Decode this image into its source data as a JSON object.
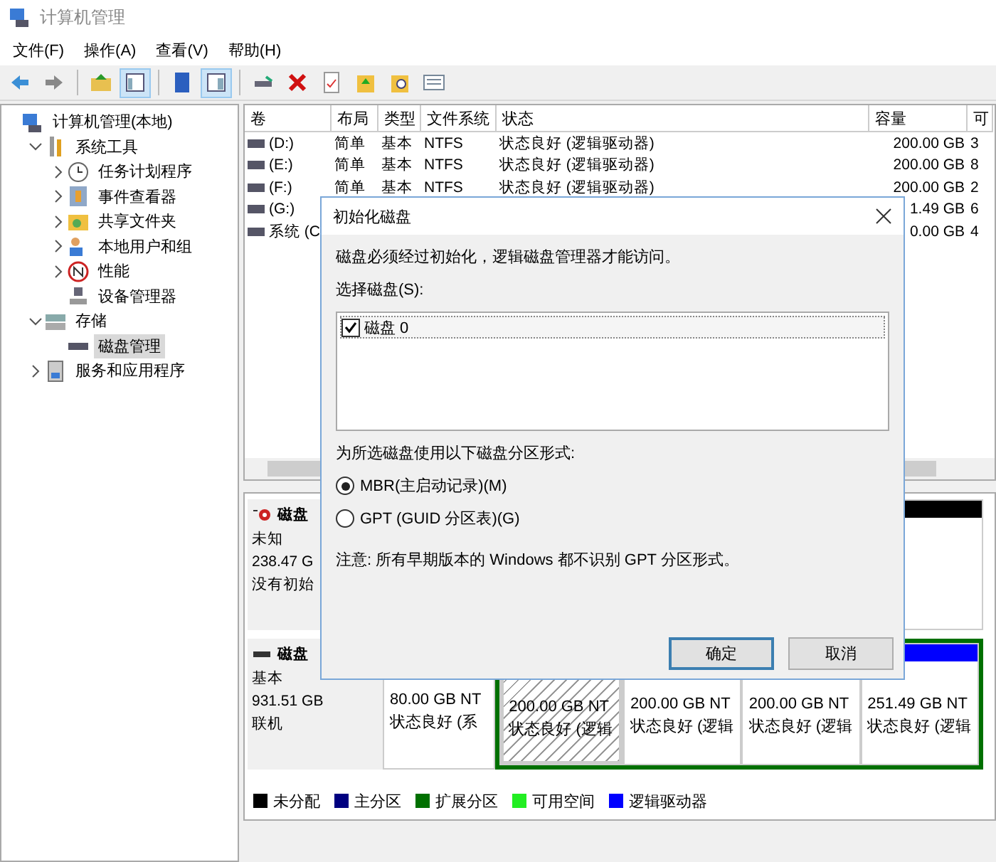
{
  "window": {
    "title": "计算机管理"
  },
  "menu": [
    {
      "label": "文件(F)"
    },
    {
      "label": "操作(A)"
    },
    {
      "label": "查看(V)"
    },
    {
      "label": "帮助(H)"
    }
  ],
  "toolbar": [
    {
      "kind": "back",
      "pressed": false
    },
    {
      "kind": "forward",
      "pressed": false
    },
    {
      "kind": "sep"
    },
    {
      "kind": "up",
      "pressed": false
    },
    {
      "kind": "tree",
      "pressed": true
    },
    {
      "kind": "sep"
    },
    {
      "kind": "help",
      "pressed": false
    },
    {
      "kind": "panel",
      "pressed": true
    },
    {
      "kind": "sep"
    },
    {
      "kind": "drive",
      "pressed": false
    },
    {
      "kind": "delete",
      "pressed": false
    },
    {
      "kind": "check",
      "pressed": false
    },
    {
      "kind": "folder-up",
      "pressed": false
    },
    {
      "kind": "folder-search",
      "pressed": false
    },
    {
      "kind": "list",
      "pressed": false
    }
  ],
  "tree": [
    {
      "label": "计算机管理(本地)",
      "kind": "computer",
      "selected": false,
      "children": [
        {
          "label": "系统工具",
          "kind": "tools",
          "expanded": true,
          "selected": false,
          "children": [
            {
              "label": "任务计划程序",
              "kind": "clock",
              "expanded": false,
              "selected": false
            },
            {
              "label": "事件查看器",
              "kind": "event",
              "expanded": false,
              "selected": false
            },
            {
              "label": "共享文件夹",
              "kind": "share",
              "expanded": false,
              "selected": false
            },
            {
              "label": "本地用户和组",
              "kind": "users",
              "expanded": false,
              "selected": false
            },
            {
              "label": "性能",
              "kind": "perf",
              "expanded": false,
              "selected": false
            },
            {
              "label": "设备管理器",
              "kind": "device",
              "selected": false
            }
          ]
        },
        {
          "label": "存储",
          "kind": "storage",
          "expanded": true,
          "selected": false,
          "children": [
            {
              "label": "磁盘管理",
              "kind": "disk",
              "selected": true
            }
          ]
        },
        {
          "label": "服务和应用程序",
          "kind": "services",
          "expanded": false,
          "selected": false
        }
      ]
    }
  ],
  "table": {
    "columns": [
      "卷",
      "布局",
      "类型",
      "文件系统",
      "状态",
      "容量",
      "可"
    ],
    "rows": [
      {
        "cells": [
          "(D:)",
          "简单",
          "基本",
          "NTFS",
          "状态良好 (逻辑驱动器)",
          "200.00 GB",
          "3"
        ]
      },
      {
        "cells": [
          "(E:)",
          "简单",
          "基本",
          "NTFS",
          "状态良好 (逻辑驱动器)",
          "200.00 GB",
          "8"
        ]
      },
      {
        "cells": [
          "(F:)",
          "简单",
          "基本",
          "NTFS",
          "状态良好 (逻辑驱动器)",
          "200.00 GB",
          "2"
        ]
      },
      {
        "cells": [
          "(G:)",
          null,
          null,
          null,
          null,
          "1.49 GB",
          "6"
        ]
      },
      {
        "cells": [
          "系统 (C",
          null,
          null,
          null,
          null,
          "0.00 GB",
          "4"
        ]
      }
    ]
  },
  "disks": [
    {
      "name": "磁盘",
      "kind": "unknown",
      "type": "未知",
      "size": "238.47 G",
      "status": "没有初始",
      "partitions": [
        {
          "kind": "unallocated",
          "selected": false
        }
      ]
    },
    {
      "name": "磁盘",
      "kind": "basic",
      "type": "基本",
      "size": "931.51 GB",
      "status": "联机",
      "partitions": [
        {
          "kind": "primary",
          "size": "80.00 GB NT",
          "status": "状态良好 (系",
          "selected": false
        },
        {
          "kind": "logical",
          "size": "200.00 GB NT",
          "status": "状态良好 (逻辑",
          "selected": true
        },
        {
          "kind": "logical",
          "size": "200.00 GB NT",
          "status": "状态良好 (逻辑",
          "selected": false
        },
        {
          "kind": "logical",
          "size": "200.00 GB NT",
          "status": "状态良好 (逻辑",
          "selected": false
        },
        {
          "kind": "logical",
          "size": "251.49 GB NT",
          "status": "状态良好 (逻辑",
          "selected": false
        }
      ]
    }
  ],
  "legend": [
    {
      "label": "未分配",
      "color": "#000000"
    },
    {
      "label": "主分区",
      "color": "#000080"
    },
    {
      "label": "扩展分区",
      "color": "#007000"
    },
    {
      "label": "可用空间",
      "color": "#22ee22"
    },
    {
      "label": "逻辑驱动器",
      "color": "#0000ff"
    }
  ],
  "dialog": {
    "title": "初始化磁盘",
    "message": "磁盘必须经过初始化，逻辑磁盘管理器才能访问。",
    "select_label": "选择磁盘(S):",
    "disks": [
      {
        "label": "磁盘 0",
        "checked": true
      }
    ],
    "style_label": "为所选磁盘使用以下磁盘分区形式:",
    "options": [
      {
        "label": "MBR(主启动记录)(M)",
        "selected": true
      },
      {
        "label": "GPT (GUID 分区表)(G)",
        "selected": false
      }
    ],
    "note": "注意: 所有早期版本的 Windows 都不识别 GPT 分区形式。",
    "buttons": [
      {
        "label": "确定",
        "default": true
      },
      {
        "label": "取消",
        "default": false
      }
    ]
  }
}
